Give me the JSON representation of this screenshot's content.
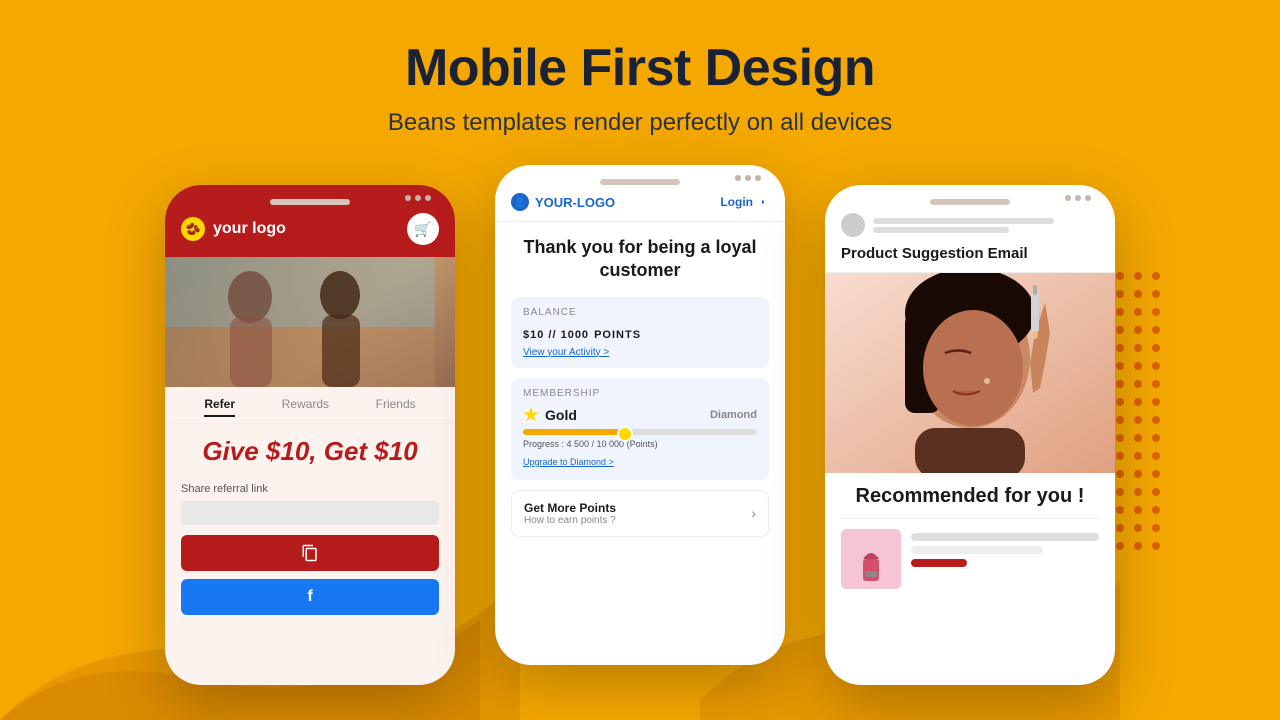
{
  "header": {
    "title": "Mobile First Design",
    "subtitle": "Beans templates render perfectly on all devices"
  },
  "phone1": {
    "logo_text": "your logo",
    "tabs": [
      "Refer",
      "Rewards",
      "Friends"
    ],
    "active_tab": "Refer",
    "give_get": "Give $10, Get $10",
    "share_label": "Share referral link",
    "copy_icon": "📋",
    "fb_icon": "f"
  },
  "phone2": {
    "logo_text": "YOUR-LOGO",
    "login_text": "Login",
    "thank_you": "Thank you for being a loyal customer",
    "balance_label": "BALANCE",
    "balance_amount": "$10 // 1000",
    "balance_unit": "POINTS",
    "view_activity": "View your Activity >",
    "membership_label": "MEMBERSHIP",
    "gold_text": "Gold",
    "diamond_text": "Diamond",
    "progress_text": "Progress : 4 500 / 10 000 (Points)",
    "upgrade_text": "Upgrade to Diamond >",
    "get_points_title": "Get More Points",
    "get_points_sub": "How to earn points ?"
  },
  "phone3": {
    "product_suggestion_title": "Product Suggestion Email",
    "recommended_text": "Recommended for you !"
  },
  "colors": {
    "background": "#F5A800",
    "red": "#B71C1C",
    "blue": "#1877F2",
    "navy": "#1a2233",
    "accent_blue": "#1a66cc"
  }
}
